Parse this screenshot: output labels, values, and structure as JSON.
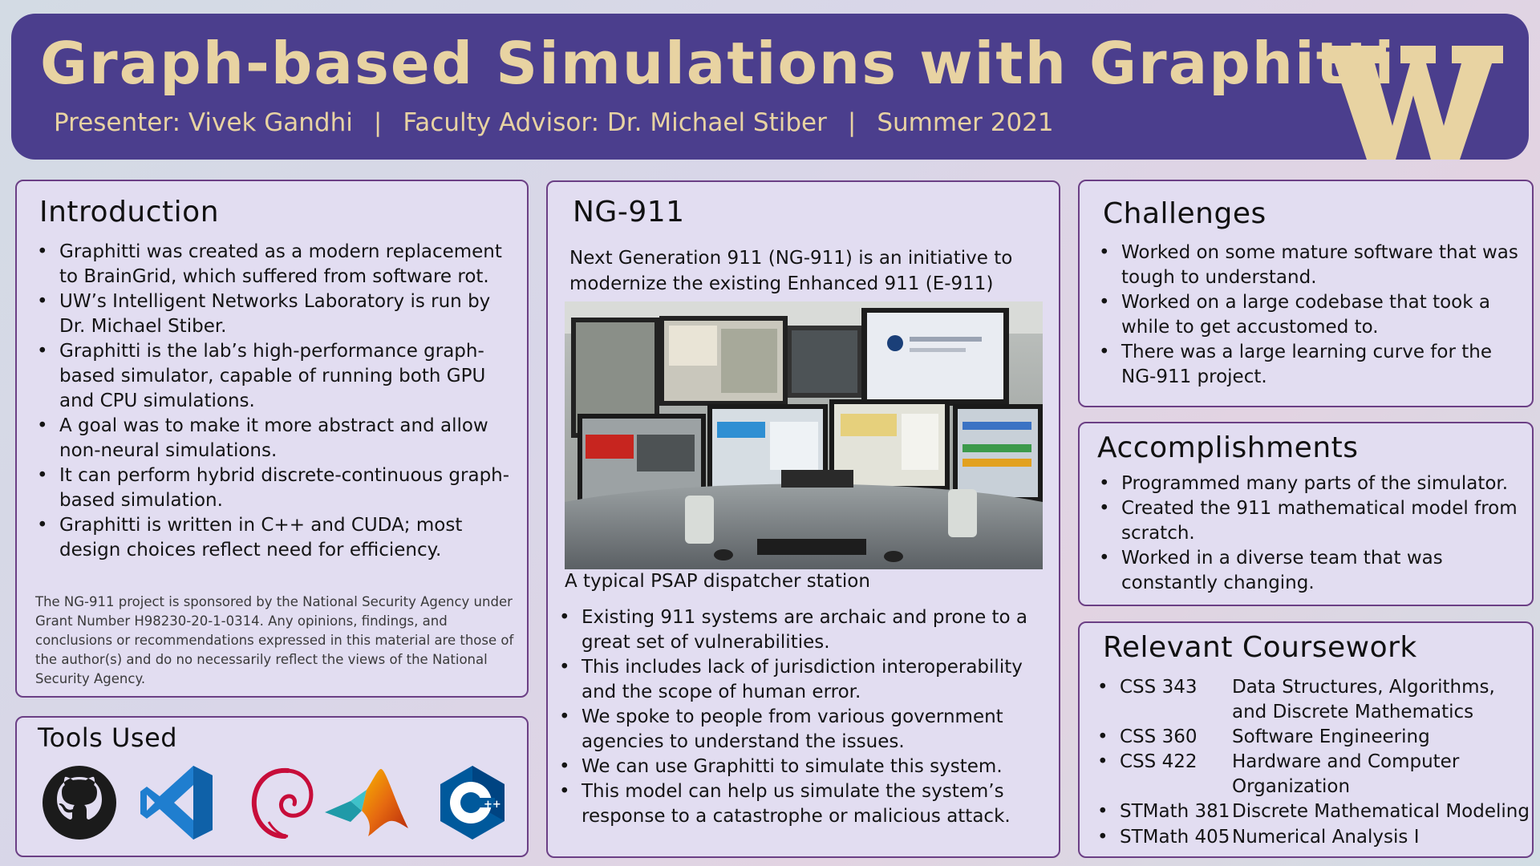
{
  "header": {
    "title": "Graph-based Simulations with Graphitti",
    "presenter": "Presenter: Vivek Gandhi",
    "separator": "|",
    "advisor": "Faculty Advisor: Dr. Michael Stiber",
    "term": "Summer 2021",
    "logo_letter": "W",
    "colors": {
      "background": "#4b3e8d",
      "text": "#e8d3a2"
    }
  },
  "introduction": {
    "heading": "Introduction",
    "bullets": [
      "Graphitti was created as a modern replacement to BrainGrid, which suffered from software rot.",
      "UW’s Intelligent Networks Laboratory is run by Dr. Michael Stiber.",
      "Graphitti is the lab’s high-performance graph-based simulator, capable of running both GPU and CPU simulations.",
      "A goal was to make it more abstract and allow non-neural simulations.",
      "It can perform hybrid discrete-continuous graph-based simulation.",
      "Graphitti is written in C++ and CUDA; most design choices reflect need for efficiency."
    ],
    "disclaimer": "The NG-911 project is sponsored by the National Security Agency under Grant Number H98230-20-1-0314. Any opinions, findings, and conclusions or recommendations expressed in this material are those of the author(s) and do no necessarily reflect the views of the National Security Agency."
  },
  "tools": {
    "heading": "Tools Used",
    "icons": [
      "github-icon",
      "vscode-icon",
      "debian-icon",
      "matlab-icon",
      "cpp-icon"
    ]
  },
  "ng911": {
    "heading": "NG-911",
    "intro": "Next Generation 911 (NG-911) is an initiative to modernize the existing Enhanced 911 (E-911) systems.",
    "caption": "A typical PSAP dispatcher station",
    "bullets": [
      "Existing 911 systems are archaic and prone to a great set of vulnerabilities.",
      "This includes lack of jurisdiction interoperability and the scope of human error.",
      "We spoke to people from various government agencies to understand the issues.",
      "We can use Graphitti to simulate this system.",
      "This model can help us simulate the system’s response to a catastrophe or malicious attack."
    ]
  },
  "challenges": {
    "heading": "Challenges",
    "bullets": [
      "Worked on some mature software that was tough to understand.",
      "Worked on a large codebase that took a while to get accustomed to.",
      "There was a large learning curve for the NG-911 project."
    ]
  },
  "accomplishments": {
    "heading": "Accomplishments",
    "bullets": [
      "Programmed many parts of the simulator.",
      "Created the 911 mathematical model from scratch.",
      "Worked in a diverse team that was constantly changing."
    ]
  },
  "coursework": {
    "heading": "Relevant Coursework",
    "courses": [
      {
        "code": "CSS 343",
        "name": "Data Structures, Algorithms, and Discrete Mathematics"
      },
      {
        "code": "CSS 360",
        "name": "Software Engineering"
      },
      {
        "code": "CSS 422",
        "name": "Hardware and Computer Organization"
      },
      {
        "code": "STMath 381",
        "name": "Discrete Mathematical Modeling"
      },
      {
        "code": "STMath 405",
        "name": "Numerical Analysis I"
      }
    ]
  }
}
